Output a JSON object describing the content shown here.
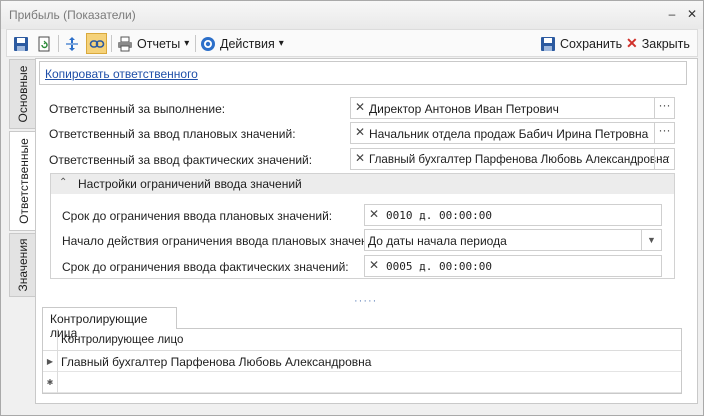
{
  "window": {
    "title": "Прибыль (Показатели)",
    "minimize": "–",
    "close": "✕"
  },
  "toolbar": {
    "reports_label": "Отчеты",
    "actions_label": "Действия",
    "save_label": "Сохранить",
    "close_label": "Закрыть",
    "dropdown_arrow": "▾"
  },
  "side_tabs": [
    {
      "label": "Основные"
    },
    {
      "label": "Ответственные"
    },
    {
      "label": "Значения"
    }
  ],
  "copy_link": "Копировать ответственного",
  "fields": {
    "execution": {
      "label": "Ответственный за выполнение:",
      "value": "Директор Антонов Иван Петрович"
    },
    "plan_input": {
      "label": "Ответственный за ввод плановых значений:",
      "value": "Начальник отдела продаж Бабич Ирина Петровна"
    },
    "fact_input": {
      "label": "Ответственный за ввод фактических значений:",
      "value": "Главный бухгалтер Парфенова Любовь Александровна"
    },
    "clear_glyph": "✕",
    "ellipsis_glyph": "···"
  },
  "limits": {
    "title": "Настройки ограничений ввода значений",
    "chevron": "⌃",
    "plan_deadline": {
      "label": "Срок до ограничения ввода плановых значений:",
      "value": "0010 д. 00:00:00"
    },
    "start": {
      "label": "Начало действия ограничения ввода плановых значений:",
      "value": "До даты начала периода"
    },
    "fact_deadline": {
      "label": "Срок до ограничения ввода фактических значений:",
      "value": "0005 д. 00:00:00"
    },
    "combo_arrow": "▼"
  },
  "splitter": "·····",
  "controllers": {
    "tab_label": "Контролирующие лица",
    "column_header": "Контролирующее лицо",
    "rows": [
      {
        "indicator": "▶",
        "value": "Главный бухгалтер Парфенова Любовь Александровна"
      }
    ],
    "new_row_indicator": "✱"
  },
  "colors": {
    "accent": "#1f4fa8",
    "close_red": "#d0302a"
  }
}
